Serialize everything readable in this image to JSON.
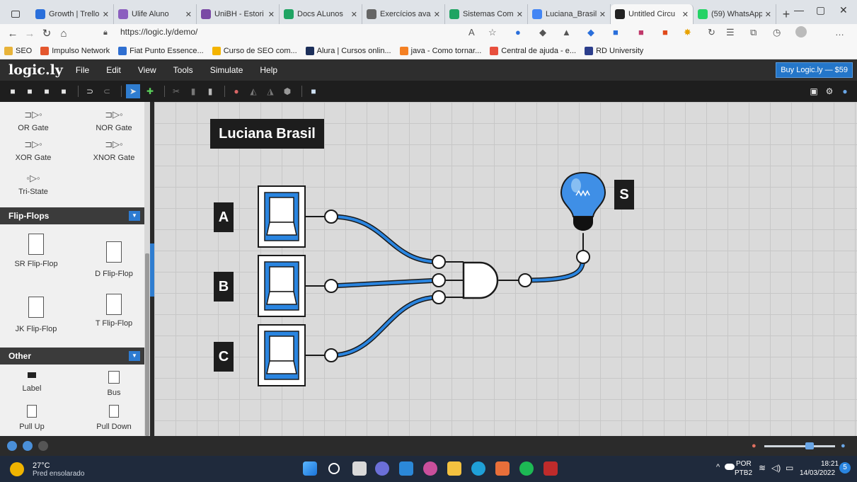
{
  "browser": {
    "tabs": [
      {
        "label": "Growth | Trello",
        "color": "#2a6fdb",
        "active": false
      },
      {
        "label": "Ulife Aluno",
        "color": "#8b5fbf",
        "active": false
      },
      {
        "label": "UniBH - Estori",
        "color": "#7a49a5",
        "active": false
      },
      {
        "label": "Docs ALunos",
        "color": "#1fa463",
        "active": false
      },
      {
        "label": "Exercícios ava",
        "color": "#666666",
        "active": false
      },
      {
        "label": "Sistemas Com",
        "color": "#1fa463",
        "active": false
      },
      {
        "label": "Luciana_Brasil",
        "color": "#4285f4",
        "active": false
      },
      {
        "label": "Untitled Circu",
        "color": "#222222",
        "active": true
      },
      {
        "label": "(59) WhatsApp",
        "color": "#25d366",
        "active": false
      }
    ],
    "url": "https://logic.ly/demo/",
    "bookmarks": [
      {
        "label": "SEO",
        "color": "#e8b339"
      },
      {
        "label": "Impulso Network",
        "color": "#e4572e"
      },
      {
        "label": "Fiat Punto Essence...",
        "color": "#2f6fd1"
      },
      {
        "label": "Curso de SEO com...",
        "color": "#f4b400"
      },
      {
        "label": "Alura | Cursos onlin...",
        "color": "#1c2f5a"
      },
      {
        "label": "java - Como tornar...",
        "color": "#f48024"
      },
      {
        "label": "Central de ajuda - e...",
        "color": "#e84f3d"
      },
      {
        "label": "RD University",
        "color": "#2c3e8c"
      }
    ]
  },
  "app": {
    "logo": "logic.ly",
    "menu": [
      "File",
      "Edit",
      "View",
      "Tools",
      "Simulate",
      "Help"
    ],
    "buy_button": "Buy Logic.ly — $59"
  },
  "sidebar": {
    "gates": [
      {
        "label": "OR Gate",
        "icon": "or-gate-icon"
      },
      {
        "label": "NOR Gate",
        "icon": "nor-gate-icon"
      },
      {
        "label": "XOR Gate",
        "icon": "xor-gate-icon"
      },
      {
        "label": "XNOR Gate",
        "icon": "xnor-gate-icon"
      },
      {
        "label": "Tri-State",
        "icon": "tri-state-icon"
      }
    ],
    "categories": [
      "Flip-Flops",
      "Other"
    ],
    "flipflops": [
      "SR Flip-Flop",
      "D Flip-Flop",
      "JK Flip-Flop",
      "T Flip-Flop"
    ],
    "other": [
      "Label",
      "Bus",
      "Pull Up",
      "Pull Down"
    ]
  },
  "circuit": {
    "title_label": "Luciana Brasil",
    "inputs": [
      {
        "label": "A",
        "state": "off"
      },
      {
        "label": "B",
        "state": "off"
      },
      {
        "label": "C",
        "state": "off"
      }
    ],
    "gate": "AND",
    "output": {
      "label": "S",
      "state": "on"
    },
    "wire_color": "#1f7bd6"
  },
  "taskbar": {
    "weather_temp": "27°C",
    "weather_desc": "Pred ensolarado",
    "lang": "POR",
    "layout": "PTB2",
    "time": "18:21",
    "date": "14/03/2022",
    "notifications": "5"
  }
}
